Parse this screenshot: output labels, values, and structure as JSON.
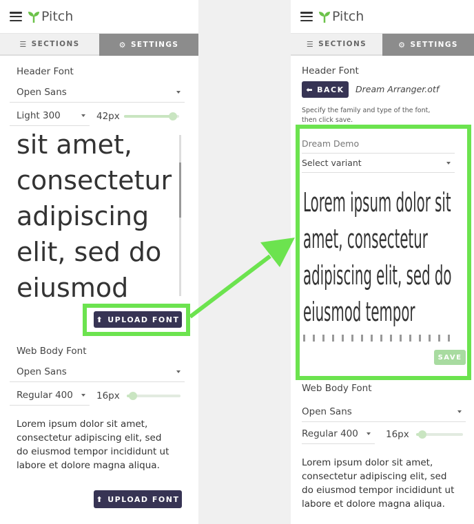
{
  "colors": {
    "accent_green": "#6ce34f",
    "button_dark": "#373454",
    "settings_tab": "#8c8c8c",
    "slider": "#c9e5c1"
  },
  "app": {
    "title": "Pitch"
  },
  "tabs": {
    "sections": "SECTIONS",
    "settings": "SETTINGS"
  },
  "left": {
    "header_font_label": "Header Font",
    "header_font_family": "Open Sans",
    "header_variant": "Light 300",
    "header_size": "42px",
    "header_size_fraction": 0.95,
    "header_preview_lines": [
      "sit amet,",
      "consectetur",
      "adipiscing",
      "elit, sed do",
      "eiusmod"
    ],
    "upload_font": "UPLOAD FONT",
    "body_font_label": "Web Body Font",
    "body_font_family": "Open Sans",
    "body_variant": "Regular 400",
    "body_size": "16px",
    "body_size_fraction": 0.05,
    "body_preview_lines": [
      "Lorem ipsum dolor sit amet,",
      "consectetur adipiscing elit, sed",
      "do eiusmod tempor incididunt ut",
      "labore et dolore magna aliqua."
    ],
    "upload_font_2": "UPLOAD FONT"
  },
  "right": {
    "header_font_label": "Header Font",
    "back": "BACK",
    "filename": "Dream Arranger.otf",
    "instructions_line1": "Specify the family and type of the font,",
    "instructions_line2": "then click save.",
    "family_value": "Dream Demo",
    "variant_placeholder": "Select variant",
    "preview_lines": [
      "Lorem ipsum dolor sit",
      "amet, consectetur",
      "adipiscing elit, sed do",
      "eiusmod tempor"
    ],
    "save": "SAVE",
    "body_font_label": "Web Body Font",
    "body_font_family": "Open Sans",
    "body_variant": "Regular 400",
    "body_size": "16px",
    "body_size_fraction": 0.05,
    "body_preview_lines": [
      "Lorem ipsum dolor sit amet,",
      "consectetur adipiscing elit, sed",
      "do eiusmod tempor incididunt ut",
      "labore et dolore magna aliqua."
    ]
  },
  "icons": {
    "menu": "hamburger-icon",
    "logo": "sprout-icon",
    "sections": "list-icon",
    "settings": "gear-icon",
    "upload": "upload-icon",
    "back": "arrow-left-icon",
    "caret": "caret-down-icon"
  }
}
